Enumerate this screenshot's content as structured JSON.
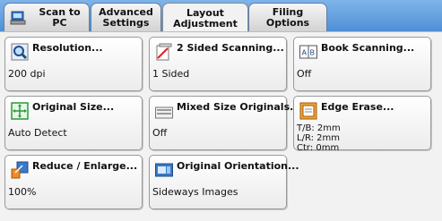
{
  "tabs": [
    {
      "label": "Scan to PC"
    },
    {
      "label_line1": "Advanced",
      "label_line2": "Settings"
    },
    {
      "label_line1": "Layout",
      "label_line2": "Adjustment"
    },
    {
      "label": "Filing Options"
    }
  ],
  "cards": {
    "resolution": {
      "title": "Resolution...",
      "value": "200 dpi"
    },
    "two_sided": {
      "title": "2 Sided Scanning...",
      "value": "1 Sided"
    },
    "book": {
      "title": "Book Scanning...",
      "value": "Off",
      "icon_text": "A B"
    },
    "original_size": {
      "title": "Original Size...",
      "value": "Auto Detect"
    },
    "mixed_size": {
      "title": "Mixed Size Originals...",
      "value": "Off"
    },
    "edge_erase": {
      "title": "Edge Erase...",
      "value_tb": "T/B: 2mm",
      "value_lr": "L/R: 2mm",
      "value_ctr": "Ctr: 0mm"
    },
    "reduce_enlarge": {
      "title": "Reduce / Enlarge...",
      "value": "100%"
    },
    "orientation": {
      "title": "Original Orientation...",
      "value": "Sideways Images"
    }
  }
}
